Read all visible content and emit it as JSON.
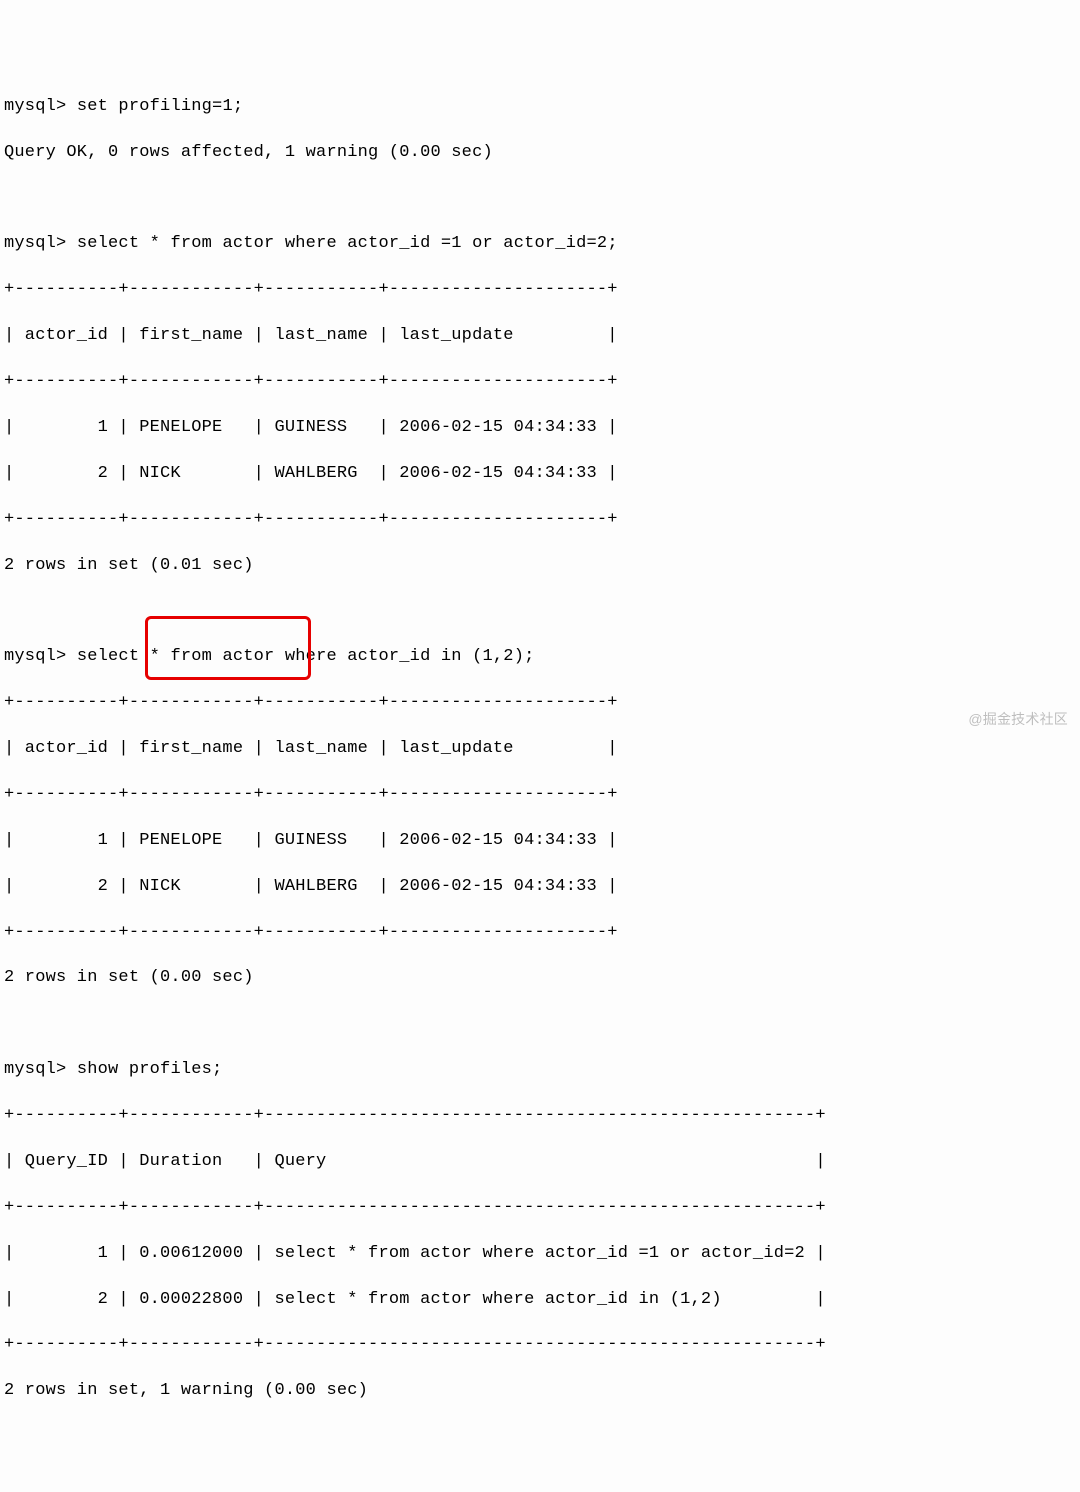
{
  "prompt": "mysql>",
  "cmds": {
    "set_profiling": "set profiling=1;",
    "q1": "select * from actor where actor_id =1 or actor_id=2;",
    "q2": "select * from actor where actor_id in (1,2);",
    "show_profiles": "show profiles;"
  },
  "responses": {
    "ok": "Query OK, 0 rows affected, 1 warning (0.00 sec)",
    "set1": "2 rows in set (0.01 sec)",
    "set2": "2 rows in set (0.00 sec)",
    "final": "2 rows in set, 1 warning (0.00 sec)"
  },
  "actor_table": {
    "border_top": "+----------+------------+-----------+---------------------+",
    "header": "| actor_id | first_name | last_name | last_update         |",
    "rows": [
      "|        1 | PENELOPE   | GUINESS   | 2006-02-15 04:34:33 |",
      "|        2 | NICK       | WAHLBERG  | 2006-02-15 04:34:33 |"
    ]
  },
  "profiles_table": {
    "border_top": "+----------+------------+-----------------------------------------------------+",
    "header": "| Query_ID | Duration   | Query                                               |",
    "rows": [
      "|        1 | 0.00612000 | select * from actor where actor_id =1 or actor_id=2 |",
      "|        2 | 0.00022800 | select * from actor where actor_id in (1,2)         |"
    ]
  },
  "watermark": "@掘金技术社区"
}
